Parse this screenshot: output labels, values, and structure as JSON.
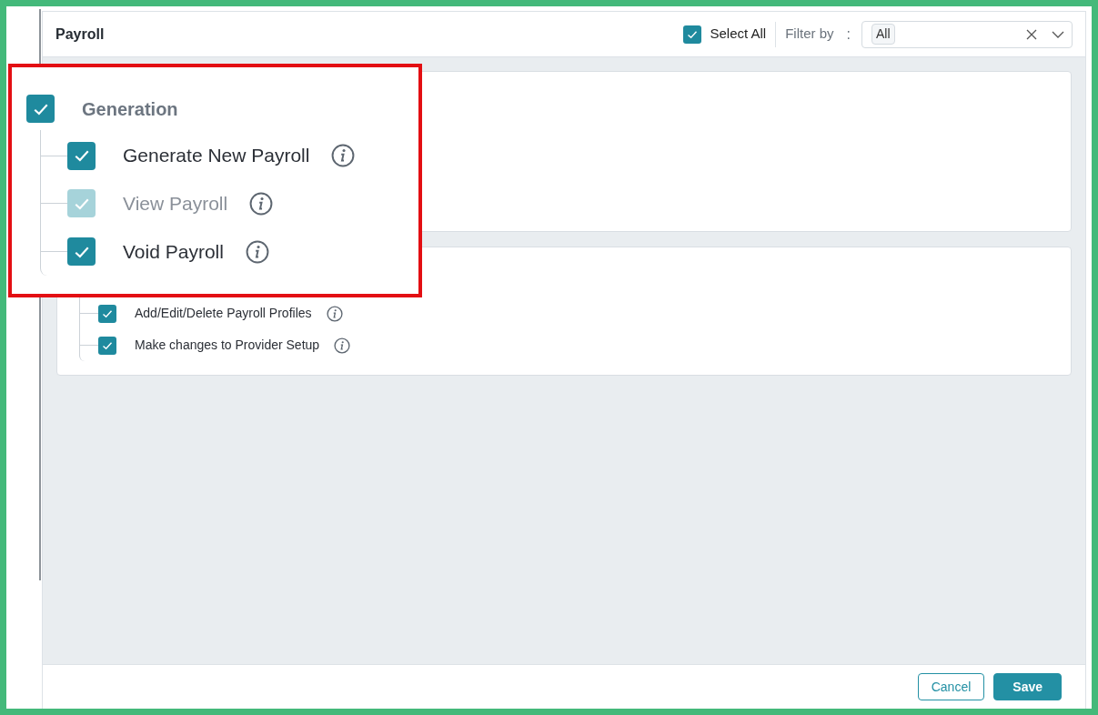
{
  "header": {
    "title": "Payroll",
    "select_all": {
      "label": "Select All",
      "checked": true
    },
    "filter": {
      "label": "Filter by",
      "separator": ":",
      "value": "All"
    }
  },
  "cards": [
    {
      "kind": "blank"
    },
    {
      "kind": "list",
      "items": [
        {
          "label": "Add/Edit/Delete Payroll Profiles",
          "checked": true,
          "disabled": false
        },
        {
          "label": "Make changes to Provider Setup",
          "checked": true,
          "disabled": false
        }
      ]
    }
  ],
  "callout": {
    "label": "Generation",
    "checked": true,
    "items": [
      {
        "label": "Generate New Payroll",
        "checked": true,
        "disabled": false
      },
      {
        "label": "View Payroll",
        "checked": true,
        "disabled": true
      },
      {
        "label": "Void Payroll",
        "checked": true,
        "disabled": false
      }
    ]
  },
  "footer": {
    "buttons": [
      {
        "label": "Cancel",
        "kind": "secondary"
      },
      {
        "label": "Save",
        "kind": "primary"
      }
    ]
  }
}
